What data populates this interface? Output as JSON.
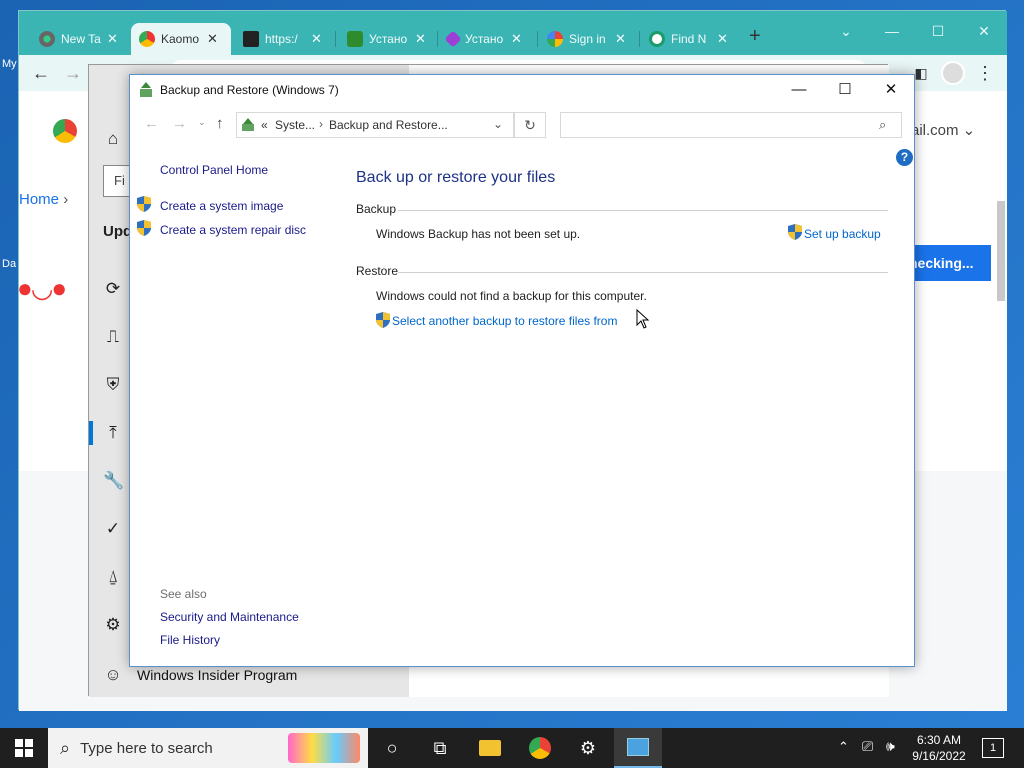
{
  "desktop": {
    "labels": [
      "My",
      "Da"
    ]
  },
  "chrome": {
    "tabs": [
      {
        "label": "New Ta",
        "icon": "chrome-icon"
      },
      {
        "label": "Kaomo",
        "icon": "kaomoji-icon"
      },
      {
        "label": "https:/",
        "icon": "site-icon"
      },
      {
        "label": "Устано",
        "icon": "download-icon"
      },
      {
        "label": "Устано",
        "icon": "extension-icon"
      },
      {
        "label": "Sign in",
        "icon": "google-icon"
      },
      {
        "label": "Find N",
        "icon": "find-icon"
      }
    ],
    "page": {
      "breadcrumb_home": "Home",
      "search_placeholder": "Fi",
      "update_label": "Upd",
      "email_suffix": "ail.com",
      "checking_button": "hecking...",
      "insider_label": "Windows Insider Program"
    }
  },
  "cp": {
    "title": "Backup and Restore (Windows 7)",
    "address": {
      "crumb_prefix": "«",
      "crumb1": "Syste...",
      "crumb2": "Backup and Restore..."
    },
    "left": {
      "home_link": "Control Panel Home",
      "system_image_link": "Create a system image",
      "repair_disc_link": "Create a system repair disc",
      "see_also": "See also",
      "security_link": "Security and Maintenance",
      "file_history_link": "File History"
    },
    "main": {
      "heading": "Back up or restore your files",
      "backup_section": "Backup",
      "backup_status": "Windows Backup has not been set up.",
      "setup_link": "Set up backup",
      "restore_section": "Restore",
      "restore_status": "Windows could not find a backup for this computer.",
      "select_backup_link": "Select another backup to restore files from"
    },
    "help": "?"
  },
  "taskbar": {
    "search_placeholder": "Type here to search",
    "time": "6:30 AM",
    "date": "9/16/2022",
    "notification_count": "1"
  }
}
